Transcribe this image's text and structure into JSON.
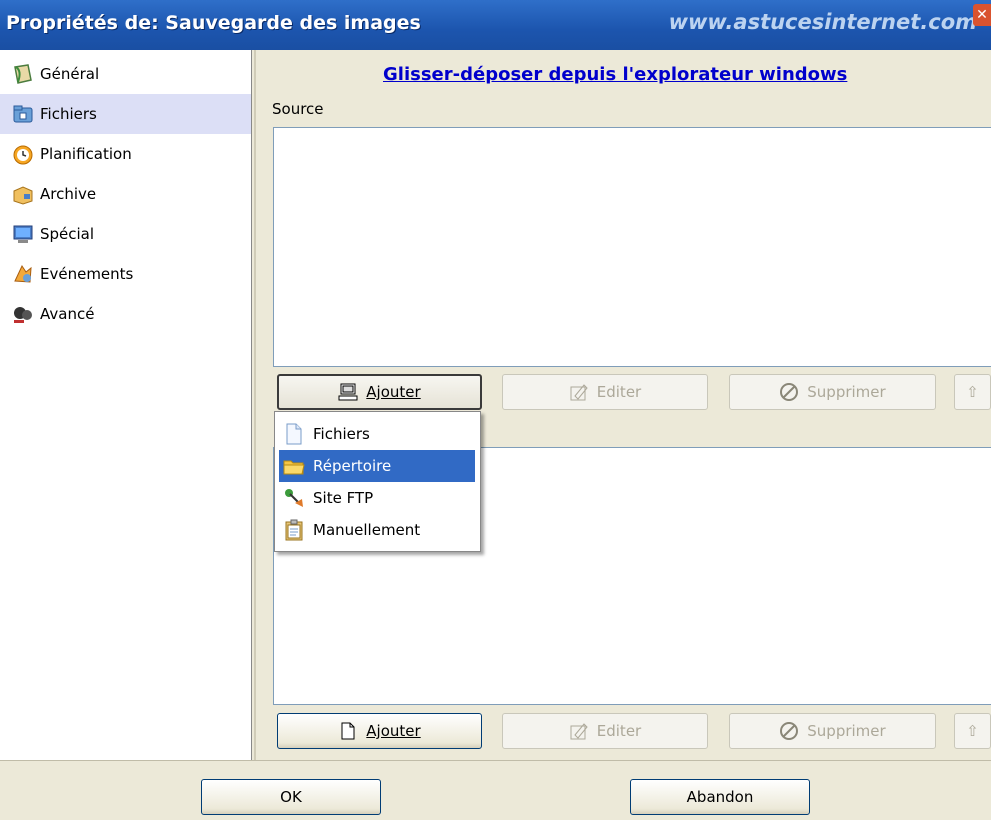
{
  "window": {
    "title": "Propriétés de: Sauvegarde des images",
    "watermark": "www.astucesinternet.com"
  },
  "sidebar": {
    "items": [
      {
        "label": "Général",
        "icon": "general-icon"
      },
      {
        "label": "Fichiers",
        "icon": "files-icon",
        "selected": true
      },
      {
        "label": "Planification",
        "icon": "clock-icon"
      },
      {
        "label": "Archive",
        "icon": "archive-box-icon"
      },
      {
        "label": "Spécial",
        "icon": "monitor-icon"
      },
      {
        "label": "Evénements",
        "icon": "events-icon"
      },
      {
        "label": "Avancé",
        "icon": "advanced-icon"
      }
    ]
  },
  "main": {
    "link_title": "Glisser-déposer depuis l'explorateur windows",
    "source_label": "Source",
    "source_buttons": {
      "add": "Ajouter",
      "edit": "Editer",
      "delete": "Supprimer"
    },
    "dest_buttons": {
      "add": "Ajouter",
      "edit": "Editer",
      "delete": "Supprimer"
    }
  },
  "dropdown": {
    "items": [
      {
        "label": "Fichiers",
        "icon": "file-icon"
      },
      {
        "label": "Répertoire",
        "icon": "folder-icon",
        "highlighted": true
      },
      {
        "label": "Site FTP",
        "icon": "ftp-icon"
      },
      {
        "label": "Manuellement",
        "icon": "clipboard-icon"
      }
    ]
  },
  "footer": {
    "ok": "OK",
    "cancel": "Abandon"
  },
  "colors": {
    "titlebar": "#1c55ae",
    "selection": "#316ac5",
    "link": "#0000cc",
    "sidebar_selected": "#dcdff6"
  }
}
